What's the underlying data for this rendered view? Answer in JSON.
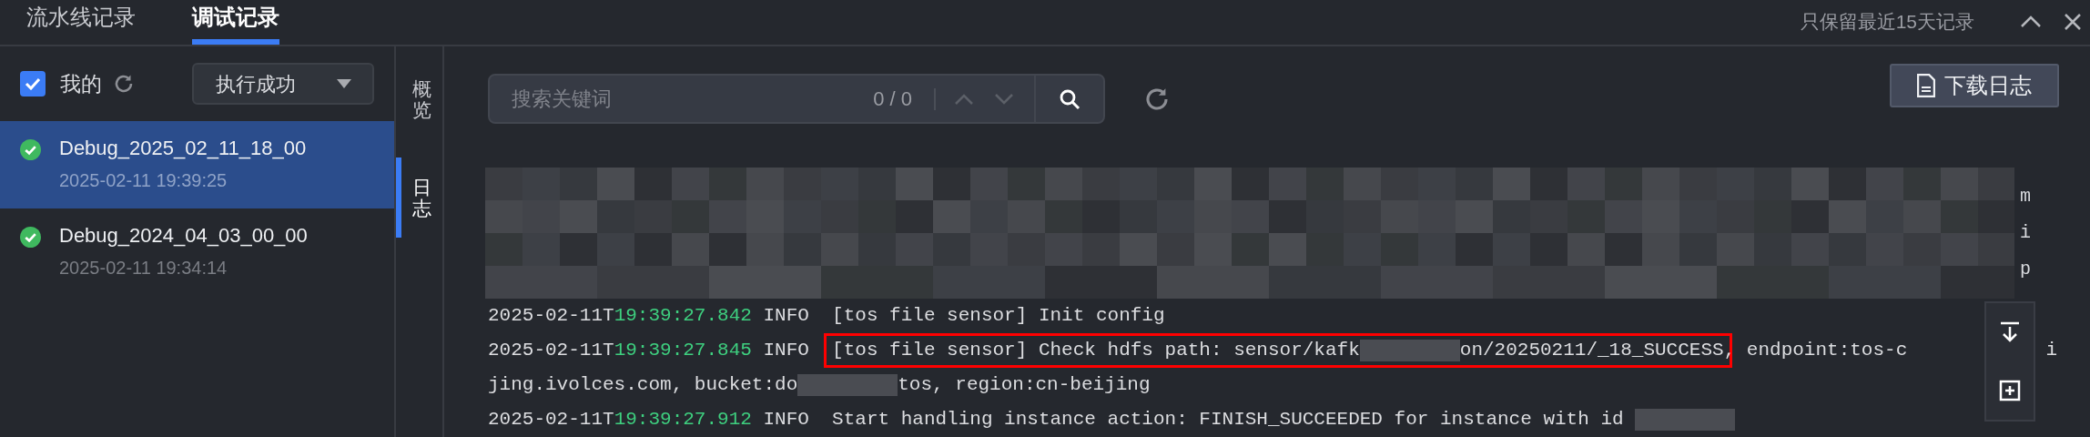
{
  "tabs": [
    {
      "label": "流水线记录",
      "selected": false
    },
    {
      "label": "调试记录",
      "selected": true
    }
  ],
  "retention_note": "只保留最近15天记录",
  "filter": {
    "mine_label": "我的",
    "mine_checked": true,
    "status_dropdown": "执行成功"
  },
  "runs": [
    {
      "name": "Debug_2025_02_11_18_00",
      "time": "2025-02-11 19:39:25",
      "selected": true
    },
    {
      "name": "Debug_2024_04_03_00_00",
      "time": "2025-02-11 19:34:14",
      "selected": false
    }
  ],
  "side_tabs": [
    {
      "label": "概览",
      "selected": false
    },
    {
      "label": "日志",
      "selected": true
    }
  ],
  "search": {
    "placeholder": "搜索关键词",
    "count": "0 / 0"
  },
  "download_button": "下载日志",
  "log": {
    "masked_block_tails": [
      "m",
      "i",
      "p"
    ],
    "rows": [
      {
        "parts": [
          {
            "kind": "plain",
            "text": "2025-02-11T"
          },
          {
            "kind": "time",
            "text": "19:39:27.842"
          },
          {
            "kind": "plain",
            "text": " INFO  [tos file sensor] Init config"
          }
        ]
      },
      {
        "parts": [
          {
            "kind": "plain",
            "text": "2025-02-11T"
          },
          {
            "kind": "time",
            "text": "19:39:27.845"
          },
          {
            "kind": "plain",
            "text": " INFO  "
          },
          {
            "kind": "frame",
            "parts": [
              {
                "kind": "plain",
                "text": "[tos file sensor] Check hdfs path: sensor/kafk"
              },
              {
                "kind": "masked"
              },
              {
                "kind": "plain",
                "text": "on/20250211/_18_SUCCESS"
              }
            ]
          },
          {
            "kind": "plain",
            "text": ", endpoint:tos-c"
          }
        ],
        "tail": "i"
      },
      {
        "parts": [
          {
            "kind": "plain",
            "text": "jing.ivolces.com, bucket:do"
          },
          {
            "kind": "masked"
          },
          {
            "kind": "plain",
            "text": "tos, region:cn-beijing"
          }
        ]
      },
      {
        "parts": [
          {
            "kind": "plain",
            "text": "2025-02-11T"
          },
          {
            "kind": "time",
            "text": "19:39:27.912"
          },
          {
            "kind": "plain",
            "text": " INFO  Start handling instance action: FINISH_SUCCEEDED for instance with id "
          },
          {
            "kind": "masked"
          }
        ]
      }
    ]
  }
}
